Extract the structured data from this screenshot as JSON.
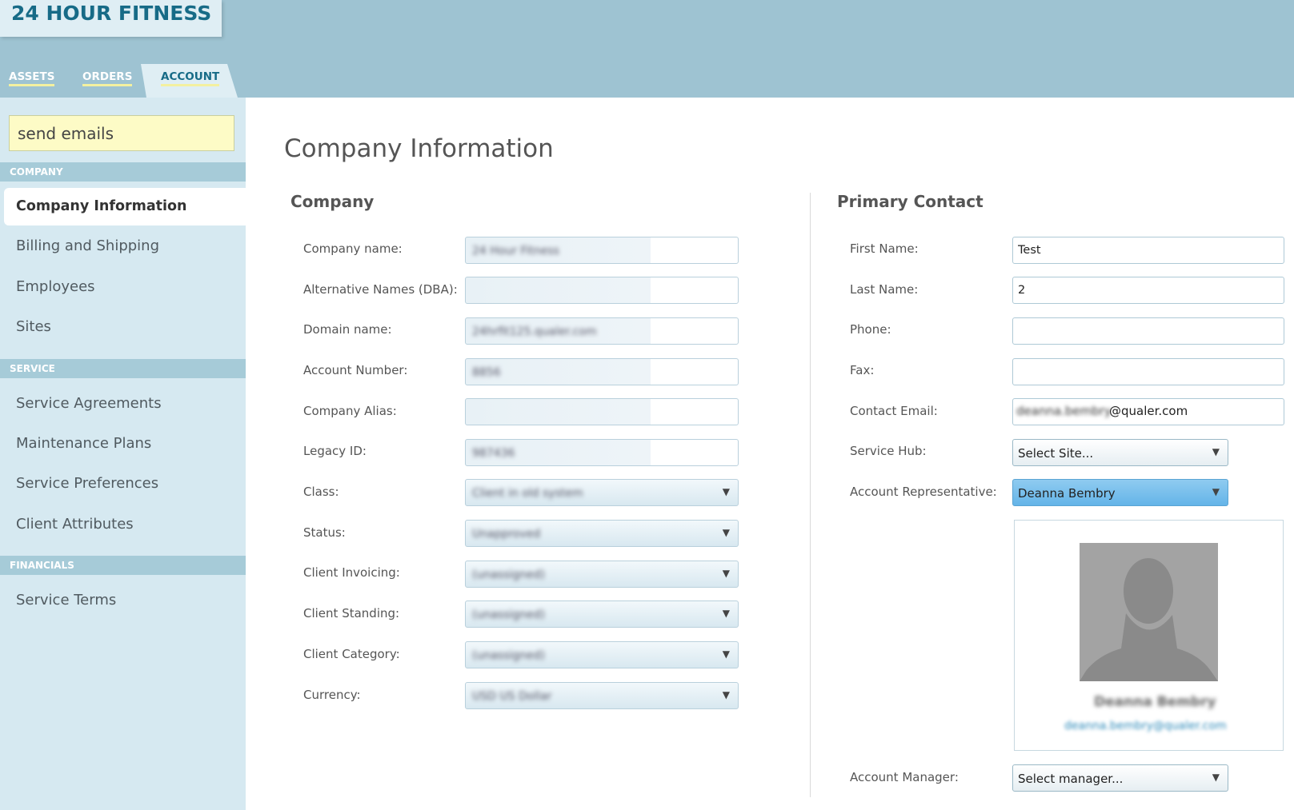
{
  "header": {
    "logo": "24 HOUR FITNESS",
    "tabs": [
      {
        "label": "ASSETS"
      },
      {
        "label": "ORDERS"
      },
      {
        "label": "ACCOUNT"
      }
    ]
  },
  "sidebar": {
    "search_value": "send emails",
    "sections": [
      {
        "title": "COMPANY",
        "items": [
          "Company Information",
          "Billing and Shipping",
          "Employees",
          "Sites"
        ]
      },
      {
        "title": "SERVICE",
        "items": [
          "Service Agreements",
          "Maintenance Plans",
          "Service Preferences",
          "Client Attributes"
        ]
      },
      {
        "title": "FINANCIALS",
        "items": [
          "Service Terms"
        ]
      }
    ]
  },
  "main": {
    "page_title": "Company Information",
    "company": {
      "title": "Company",
      "fields": [
        {
          "label": "Company name:",
          "value": "24 Hour Fitness"
        },
        {
          "label": "Alternative Names (DBA):",
          "value": ""
        },
        {
          "label": "Domain name:",
          "value": "24hrfit125.qualer.com"
        },
        {
          "label": "Account Number:",
          "value": "8856"
        },
        {
          "label": "Company Alias:",
          "value": ""
        },
        {
          "label": "Legacy ID:",
          "value": "987436"
        },
        {
          "label": "Class:",
          "value": "Client in old system"
        },
        {
          "label": "Status:",
          "value": "Unapproved"
        },
        {
          "label": "Client Invoicing:",
          "value": "(unassigned)"
        },
        {
          "label": "Client Standing:",
          "value": "(unassigned)"
        },
        {
          "label": "Client Category:",
          "value": "(unassigned)"
        },
        {
          "label": "Currency:",
          "value": "USD US Dollar"
        }
      ]
    },
    "contact": {
      "title": "Primary Contact",
      "first_name_label": "First Name:",
      "first_name": "Test",
      "last_name_label": "Last Name:",
      "last_name": "2",
      "phone_label": "Phone:",
      "phone": "",
      "fax_label": "Fax:",
      "fax": "",
      "email_label": "Contact Email:",
      "email_prefix": "deanna.bembry",
      "email_suffix": "@qualer.com",
      "hub_label": "Service Hub:",
      "hub_value": "Select Site...",
      "rep_label": "Account Representative:",
      "rep_value": "Deanna Bembry",
      "rep_card_name": "Deanna Bembry",
      "rep_card_email": "deanna.bembry@qualer.com",
      "manager_label": "Account Manager:",
      "manager_value": "Select manager..."
    }
  },
  "colors": {
    "header_bg": "#9ec3d2",
    "sidebar_bg": "#d6e9f1",
    "brand": "#176b87",
    "accent_underline": "#f3f0a0",
    "rep_select": "#6ab8ea"
  }
}
